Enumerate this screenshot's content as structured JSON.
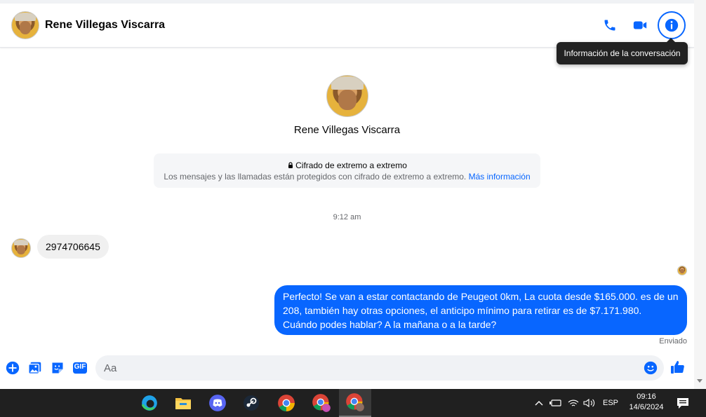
{
  "header": {
    "contact_name": "Rene Villegas Viscarra",
    "call_icon": "phone-icon",
    "video_icon": "video-camera-icon",
    "info_icon": "info-icon",
    "tooltip": "Información de la conversación"
  },
  "profile": {
    "name": "Rene Villegas Viscarra"
  },
  "encryption": {
    "title": "Cifrado de extremo a extremo",
    "description": "Los mensajes y las llamadas están protegidos con cifrado de extremo a extremo.",
    "link": "Más información"
  },
  "conversation": {
    "timestamp": "9:12 am",
    "incoming_message": "2974706645",
    "outgoing_message": "Perfecto!  Se van a estar contactando de Peugeot 0km, La cuota desde $165.000. es de un 208, también hay otras opciones, el anticipo mínimo para retirar es de $7.171.980. Cuándo podes hablar? A la mañana o a la tarde?",
    "status": "Enviado"
  },
  "composer": {
    "placeholder": "Aa",
    "gif_label": "GIF"
  },
  "taskbar": {
    "apps": [
      "edge-icon",
      "file-explorer-icon",
      "discord-icon",
      "steam-icon",
      "chrome-icon",
      "chrome-profile-icon",
      "chrome-profile-active-icon"
    ],
    "language": "ESP",
    "time": "09:16",
    "date": "14/6/2024"
  },
  "colors": {
    "accent": "#0866ff",
    "bubble_incoming": "#f0f0f0",
    "taskbar": "#202020"
  }
}
